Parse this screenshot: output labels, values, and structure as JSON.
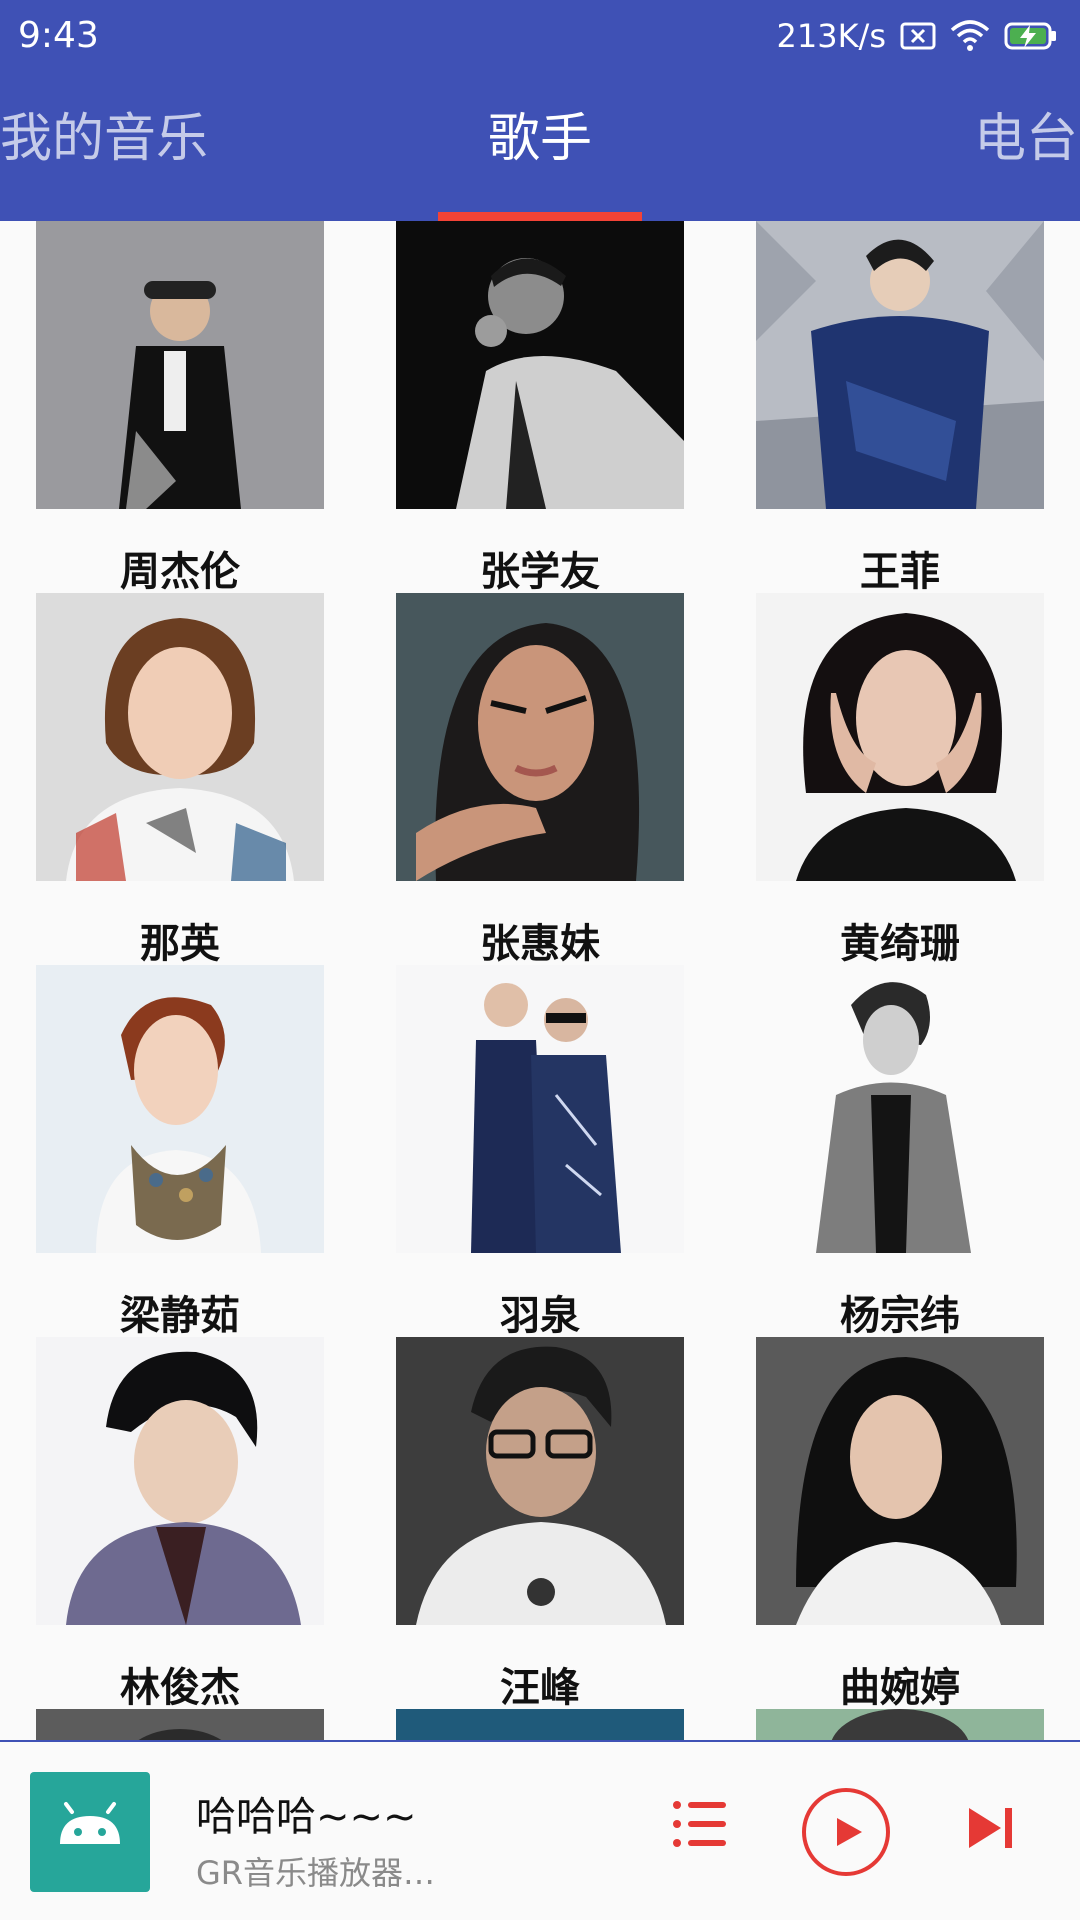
{
  "status_bar": {
    "time": "9:43",
    "network_speed": "213K/s",
    "icons": [
      "no-sim-icon",
      "wifi-icon",
      "battery-charging-icon"
    ]
  },
  "tabs": [
    {
      "label": "我的音乐",
      "active": false
    },
    {
      "label": "歌手",
      "active": true
    },
    {
      "label": "电台",
      "active": false
    }
  ],
  "colors": {
    "primary": "#3f51b5",
    "accent": "#f44336",
    "app_icon": "#26a69a"
  },
  "singers": [
    {
      "name": "周杰伦"
    },
    {
      "name": "张学友"
    },
    {
      "name": "王菲"
    },
    {
      "name": "那英"
    },
    {
      "name": "张惠妹"
    },
    {
      "name": "黄绮珊"
    },
    {
      "name": "梁静茹"
    },
    {
      "name": "羽泉"
    },
    {
      "name": "杨宗纬"
    },
    {
      "name": "林俊杰"
    },
    {
      "name": "汪峰"
    },
    {
      "name": "曲婉婷"
    },
    {
      "name": ""
    },
    {
      "name": ""
    },
    {
      "name": ""
    }
  ],
  "player": {
    "title": "哈哈哈~~~",
    "subtitle": "GR音乐播放器…",
    "icons": [
      "android-app-icon",
      "playlist-icon",
      "play-icon",
      "skip-next-icon"
    ]
  }
}
